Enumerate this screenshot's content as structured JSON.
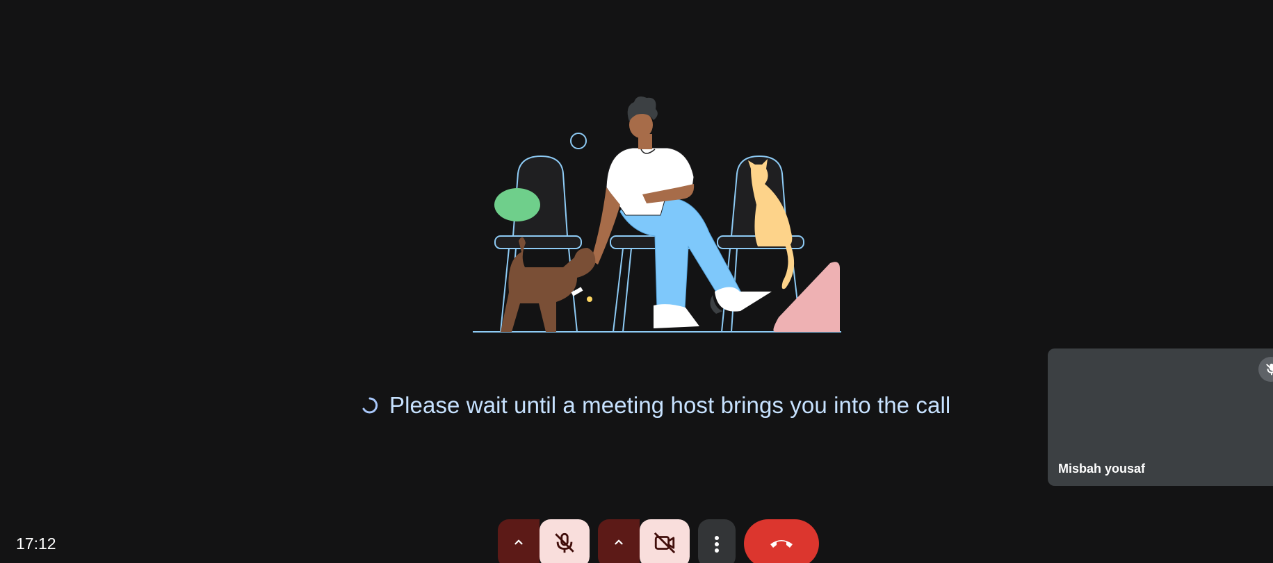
{
  "status": {
    "waiting_message": "Please wait until a meeting host brings you into the call",
    "spinner_icon": "loading-spinner-icon"
  },
  "self_tile": {
    "name": "Misbah yousaf",
    "mic_icon": "mic-off-icon"
  },
  "clock": {
    "time": "17:12"
  },
  "controls": {
    "mic_options_icon": "chevron-up-icon",
    "mic_toggle_icon": "mic-off-icon",
    "camera_options_icon": "chevron-up-icon",
    "camera_toggle_icon": "videocam-off-icon",
    "more_options_icon": "more-vert-icon",
    "leave_call_icon": "call-end-icon"
  },
  "colors": {
    "background": "#131314",
    "accent_text": "#c7e2ff",
    "off_button_bg": "#f9dedc",
    "off_button_dark": "#5c1a17",
    "leave_red": "#dc362e",
    "tile_bg": "#3c4043"
  }
}
